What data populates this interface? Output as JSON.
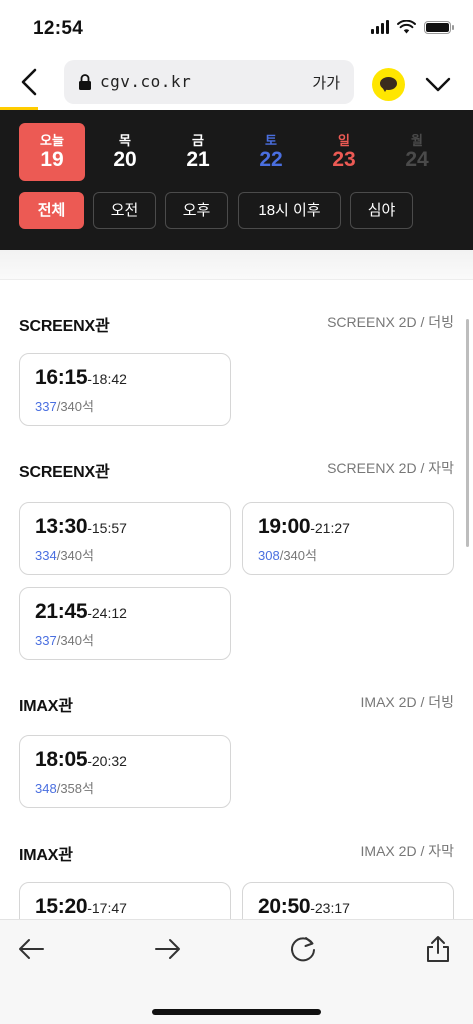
{
  "status": {
    "time": "12:54"
  },
  "browser": {
    "url": "cgv.co.kr",
    "text_size_label": "가가",
    "accent": "#ffcc00",
    "load_progress": 0.08
  },
  "dates": [
    {
      "day": "오늘",
      "date": "19",
      "color": "#ffffff",
      "active": true
    },
    {
      "day": "목",
      "date": "20",
      "color": "#ffffff",
      "active": false
    },
    {
      "day": "금",
      "date": "21",
      "color": "#ffffff",
      "active": false
    },
    {
      "day": "토",
      "date": "22",
      "color": "#4a6fe0",
      "active": false
    },
    {
      "day": "일",
      "date": "23",
      "color": "#ec5a54",
      "active": false
    },
    {
      "day": "월",
      "date": "24",
      "color": "#4a4a4a",
      "active": false
    }
  ],
  "filters": [
    "전체",
    "오전",
    "오후",
    "18시 이후",
    "심야"
  ],
  "active_filter": "전체",
  "sections": [
    {
      "hall": "SCREENX관",
      "format": "SCREENX 2D / 더빙",
      "showtimes": [
        {
          "start": "16:15",
          "end": "-18:42",
          "available": "337",
          "total": "/340석"
        }
      ]
    },
    {
      "hall": "SCREENX관",
      "format": "SCREENX 2D / 자막",
      "showtimes": [
        {
          "start": "13:30",
          "end": "-15:57",
          "available": "334",
          "total": "/340석"
        },
        {
          "start": "19:00",
          "end": "-21:27",
          "available": "308",
          "total": "/340석"
        },
        {
          "start": "21:45",
          "end": "-24:12",
          "available": "337",
          "total": "/340석"
        }
      ]
    },
    {
      "hall": "IMAX관",
      "format": "IMAX 2D / 더빙",
      "showtimes": [
        {
          "start": "18:05",
          "end": "-20:32",
          "available": "348",
          "total": "/358석"
        }
      ]
    },
    {
      "hall": "IMAX관",
      "format": "IMAX 2D / 자막",
      "showtimes": [
        {
          "start": "15:20",
          "end": "-17:47",
          "available": "",
          "total": ""
        },
        {
          "start": "20:50",
          "end": "-23:17",
          "available": "",
          "total": ""
        }
      ]
    }
  ],
  "toolbar": {
    "items": [
      {
        "icon": "back-arrow-icon"
      },
      {
        "icon": "forward-arrow-icon"
      },
      {
        "icon": "refresh-icon"
      },
      {
        "icon": "share-icon"
      }
    ]
  },
  "colors": {
    "accent_red": "#ec5a54",
    "seat_blue": "#4a6fe0",
    "header_bg": "#191919"
  }
}
